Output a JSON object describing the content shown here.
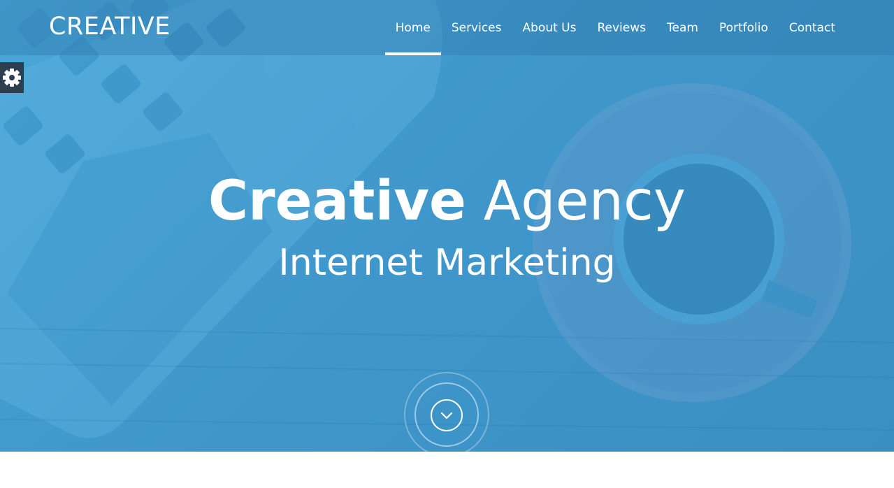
{
  "brand": {
    "logo_text": "CREATIVE"
  },
  "nav": {
    "items": [
      {
        "label": "Home",
        "active": true
      },
      {
        "label": "Services",
        "active": false
      },
      {
        "label": "About Us",
        "active": false
      },
      {
        "label": "Reviews",
        "active": false
      },
      {
        "label": "Team",
        "active": false
      },
      {
        "label": "Portfolio",
        "active": false
      },
      {
        "label": "Contact",
        "active": false
      }
    ]
  },
  "hero": {
    "title_bold": "Creative",
    "title_light": "Agency",
    "subtitle": "Internet Marketing"
  },
  "icons": {
    "settings": "gear-icon",
    "scroll": "chevron-down-icon"
  },
  "colors": {
    "hero_blue": "#4aa6d8",
    "settings_bg": "#2c3e50",
    "text": "#ffffff"
  }
}
